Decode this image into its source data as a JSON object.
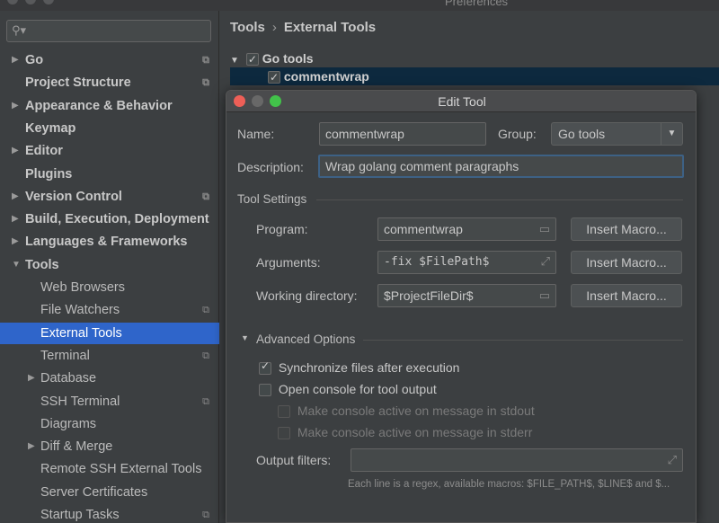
{
  "window": {
    "title": "Preferences"
  },
  "search": {
    "placeholder": ""
  },
  "sidebar": {
    "items": [
      {
        "label": "Go",
        "arrow": "▶",
        "bold": true,
        "project": true
      },
      {
        "label": "Project Structure",
        "arrow": "",
        "bold": true,
        "project": true
      },
      {
        "label": "Appearance & Behavior",
        "arrow": "▶",
        "bold": true,
        "project": false
      },
      {
        "label": "Keymap",
        "arrow": "",
        "bold": true,
        "project": false
      },
      {
        "label": "Editor",
        "arrow": "▶",
        "bold": true,
        "project": false
      },
      {
        "label": "Plugins",
        "arrow": "",
        "bold": true,
        "project": false
      },
      {
        "label": "Version Control",
        "arrow": "▶",
        "bold": true,
        "project": true
      },
      {
        "label": "Build, Execution, Deployment",
        "arrow": "▶",
        "bold": true,
        "project": false
      },
      {
        "label": "Languages & Frameworks",
        "arrow": "▶",
        "bold": true,
        "project": false
      },
      {
        "label": "Tools",
        "arrow": "▼",
        "bold": true,
        "project": false
      },
      {
        "label": "Web Browsers",
        "arrow": "",
        "bold": false,
        "project": false
      },
      {
        "label": "File Watchers",
        "arrow": "",
        "bold": false,
        "project": true
      },
      {
        "label": "External Tools",
        "arrow": "",
        "bold": false,
        "project": false,
        "selected": true
      },
      {
        "label": "Terminal",
        "arrow": "",
        "bold": false,
        "project": true
      },
      {
        "label": "Database",
        "arrow": "▶",
        "bold": false,
        "project": false
      },
      {
        "label": "SSH Terminal",
        "arrow": "",
        "bold": false,
        "project": true
      },
      {
        "label": "Diagrams",
        "arrow": "",
        "bold": false,
        "project": false
      },
      {
        "label": "Diff & Merge",
        "arrow": "▶",
        "bold": false,
        "project": false
      },
      {
        "label": "Remote SSH External Tools",
        "arrow": "",
        "bold": false,
        "project": false
      },
      {
        "label": "Server Certificates",
        "arrow": "",
        "bold": false,
        "project": false
      },
      {
        "label": "Startup Tasks",
        "arrow": "",
        "bold": false,
        "project": true
      }
    ]
  },
  "breadcrumb": {
    "parent": "Tools",
    "separator": "›",
    "current": "External Tools"
  },
  "tool_tree": {
    "group": {
      "label": "Go tools",
      "checked": true
    },
    "tool": {
      "label": "commentwrap",
      "checked": true
    }
  },
  "dialog": {
    "title": "Edit Tool",
    "name_label": "Name:",
    "name_value": "commentwrap",
    "group_label": "Group:",
    "group_value": "Go tools",
    "description_label": "Description:",
    "description_value": "Wrap golang comment paragraphs",
    "tool_settings_label": "Tool Settings",
    "program_label": "Program:",
    "program_value": "commentwrap",
    "arguments_label": "Arguments:",
    "arguments_value": "-fix $FilePath$",
    "working_dir_label": "Working directory:",
    "working_dir_value": "$ProjectFileDir$",
    "insert_macro_label": "Insert Macro...",
    "advanced_label": "Advanced Options",
    "sync_label": "Synchronize files after execution",
    "sync_checked": true,
    "open_console_label": "Open console for tool output",
    "open_console_checked": false,
    "console_stdout_label": "Make console active on message in stdout",
    "console_stderr_label": "Make console active on message in stderr",
    "output_filters_label": "Output filters:",
    "output_filters_value": "",
    "hint": "Each line is a regex, available macros: $FILE_PATH$, $LINE$ and $..."
  }
}
